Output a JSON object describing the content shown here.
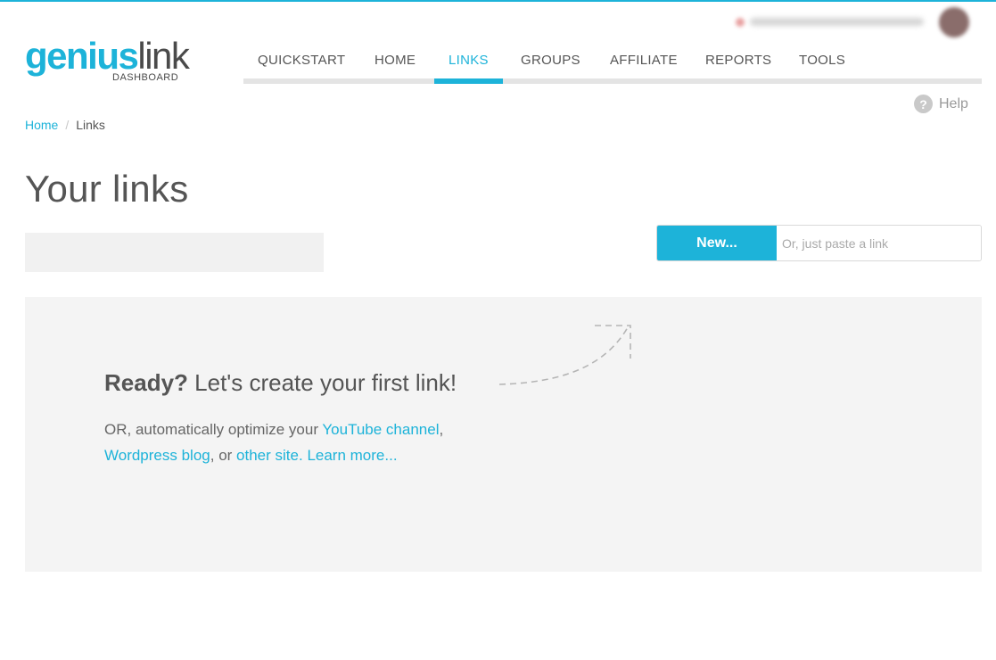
{
  "logo": {
    "part1": "genius",
    "part2": "link",
    "subtitle": "DASHBOARD"
  },
  "nav": {
    "items": [
      {
        "label": "QUICKSTART",
        "active": false
      },
      {
        "label": "HOME",
        "active": false
      },
      {
        "label": "LINKS",
        "active": true
      },
      {
        "label": "GROUPS",
        "active": false
      },
      {
        "label": "AFFILIATE",
        "active": false
      },
      {
        "label": "REPORTS",
        "active": false
      },
      {
        "label": "TOOLS",
        "active": false
      }
    ]
  },
  "help": {
    "label": "Help",
    "icon": "question-circle-icon"
  },
  "breadcrumb": {
    "home": "Home",
    "separator": "/",
    "current": "Links"
  },
  "page": {
    "title": "Your links"
  },
  "new_link": {
    "button_label": "New...",
    "input_placeholder": "Or, just paste a link"
  },
  "empty_state": {
    "headline_bold": "Ready?",
    "headline_rest": " Let's create your first link!",
    "desc_prefix": "OR, automatically optimize your ",
    "link_youtube": "YouTube channel",
    "comma": ",",
    "link_wordpress": "Wordpress blog",
    "desc_mid": ", or ",
    "link_other": "other site.",
    "space": " ",
    "link_learn": "Learn more..."
  },
  "colors": {
    "accent": "#1db3d9",
    "panel_bg": "#f4f4f4",
    "rail": "#e4e4e4"
  }
}
